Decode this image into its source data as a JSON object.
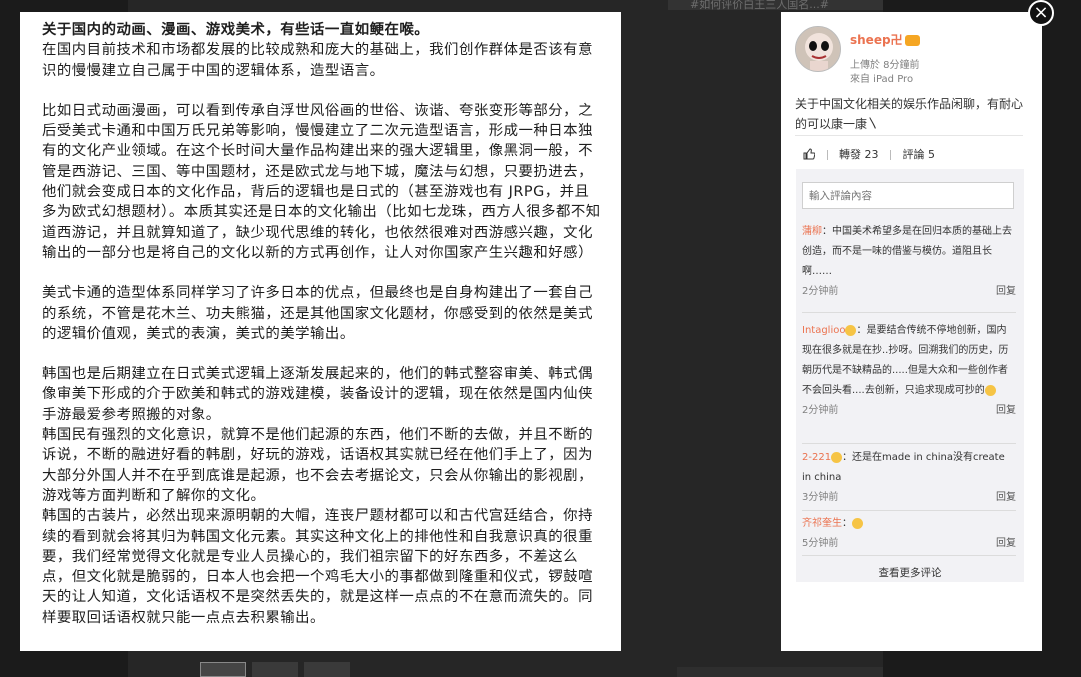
{
  "background": {
    "hint_text": "#如何评价白王三人国名...#"
  },
  "article": {
    "paragraphs": [
      {
        "text": "关于国内的动画、漫画、游戏美术，有些话一直如鲠在喉。",
        "style": "title"
      },
      {
        "text": "在国内目前技术和市场都发展的比较成熟和庞大的基础上，我们创作群体是否该有意识的慢慢建立自己属于中国的逻辑体系，造型语言。",
        "style": "normal"
      },
      {
        "text": "比如日式动画漫画，可以看到传承自浮世风俗画的世俗、诙谐、夸张变形等部分，之后受美式卡通和中国万氏兄弟等影响，慢慢建立了二次元造型语言，形成一种日本独有的文化产业领域。在这个长时间大量作品构建出来的强大逻辑里，像黑洞一般，不管是西游记、三国、等中国题材，还是欧式龙与地下城，魔法与幻想，只要扔进去，他们就会变成日本的文化作品，背后的逻辑也是日式的（甚至游戏也有 JRPG，并且多为欧式幻想题材）。本质其实还是日本的文化输出（比如七龙珠，西方人很多都不知道西游记，并且就算知道了，缺少现代思维的转化，也依然很难对西游感兴趣，文化输出的一部分也是将自己的文化以新的方式再创作，让人对你国家产生兴趣和好感）",
        "style": "gap"
      },
      {
        "text": "美式卡通的造型体系同样学习了许多日本的优点，但最终也是自身构建出了一套自己的系统，不管是花木兰、功夫熊猫，还是其他国家文化题材，你感受到的依然是美式的逻辑价值观，美式的表演，美式的美学输出。",
        "style": "gap"
      },
      {
        "text": "韩国也是后期建立在日式美式逻辑上逐渐发展起来的，他们的韩式整容审美、韩式偶像审美下形成的介于欧美和韩式的游戏建模，装备设计的逻辑，现在依然是国内仙侠手游最爱参考照搬的对象。",
        "style": "gap"
      },
      {
        "text": "韩国民有强烈的文化意识，就算不是他们起源的东西，他们不断的去做，并且不断的诉说，不断的融进好看的韩剧，好玩的游戏，话语权其实就已经在他们手上了，因为大部分外国人并不在乎到底谁是起源，也不会去考据论文，只会从你输出的影视剧，游戏等方面判断和了解你的文化。",
        "style": "normal"
      },
      {
        "text": "韩国的古装片，必然出现来源明朝的大帽，连丧尸题材都可以和古代宫廷结合，你持续的看到就会将其归为韩国文化元素。其实这种文化上的排他性和自我意识真的很重要，我们经常觉得文化就是专业人员操心的，我们祖宗留下的好东西多，不差这么点，但文化就是脆弱的，日本人也会把一个鸡毛大小的事都做到隆重和仪式，锣鼓喧天的让人知道，文化话语权不是突然丢失的，就是这样一点点的不在意而流失的。同样要取回话语权就只能一点点去积累输出。",
        "style": "normal"
      }
    ]
  },
  "post": {
    "username": "sheep卍",
    "uploaded": "上傳於 8分鐘前",
    "source": "來自 iPad Pro",
    "caption": "关于中国文化相关的娱乐作品闲聊，有耐心的可以康一康〵",
    "repost_label": "轉發 23",
    "comment_label": "評論 5"
  },
  "comments": {
    "input_placeholder": "輸入評論內容",
    "items": [
      {
        "author": "蒲柳",
        "text": "：中国美术希望多是在回归本质的基础上去创造，而不是一味的借鉴与模仿。道阻且长啊……",
        "time": "2分钟前",
        "reply": "回复"
      },
      {
        "author": "Intaglioo",
        "text": "：是要结合传统不停地创新，国内现在很多就是在抄..抄呀。回溯我们的历史，历朝历代是不缺精品的.....但是大众和一些创作者不会回头看....去创新，只追求现成可抄的",
        "time": "2分钟前",
        "reply": "回复"
      },
      {
        "author": "2-221",
        "text": "：还是在made in china没有create in china",
        "time": "3分钟前",
        "reply": "回复"
      },
      {
        "author": "齐祁奎生",
        "text": "：",
        "time": "5分钟前",
        "reply": "回复"
      }
    ],
    "more_label": "查看更多评论"
  },
  "icons": {
    "close": "close-icon",
    "like": "thumbs-up-icon",
    "vip": "vip-badge-icon"
  },
  "colors": {
    "accent": "#eb7350",
    "panel_bg": "#f2f2f5",
    "overlay": "#1b1b1b"
  }
}
